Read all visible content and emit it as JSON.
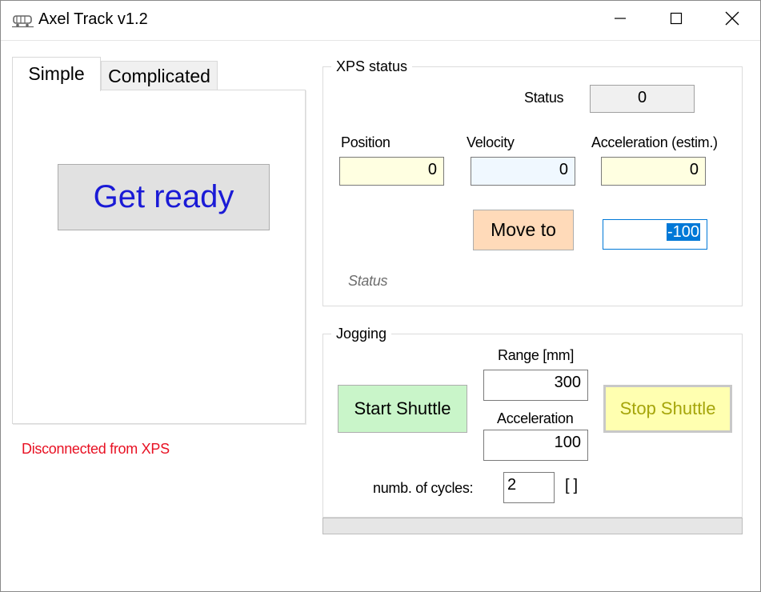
{
  "window": {
    "title": "Axel Track v1.2",
    "icon": "train-icon",
    "controls": [
      "minimize-icon",
      "maximize-icon",
      "close-icon"
    ]
  },
  "tabs": [
    {
      "label": "Simple",
      "active": true
    },
    {
      "label": "Complicated",
      "active": false
    }
  ],
  "simple": {
    "get_ready_label": "Get ready",
    "get_ready_color": "#1a1ad6"
  },
  "connection_status": {
    "text": "Disconnected from XPS",
    "color": "#e81123"
  },
  "xps_status": {
    "legend": "XPS status",
    "status_label": "Status",
    "status_value": "0",
    "position_label": "Position",
    "position_value": "0",
    "velocity_label": "Velocity",
    "velocity_value": "0",
    "acceleration_label": "Acceleration (estim.)",
    "acceleration_value": "0",
    "move_to_label": "Move to",
    "move_to_value": "-100",
    "status_text": "Status"
  },
  "jogging": {
    "legend": "Jogging",
    "range_label": "Range [mm]",
    "range_value": "300",
    "acceleration_label": "Acceleration",
    "acceleration_value": "100",
    "start_label": "Start Shuttle",
    "stop_label": "Stop Shuttle",
    "cycles_label": "numb. of cycles:",
    "cycles_value": "2",
    "cycles_unit": "[ ]"
  },
  "progress": {
    "value": 0
  }
}
